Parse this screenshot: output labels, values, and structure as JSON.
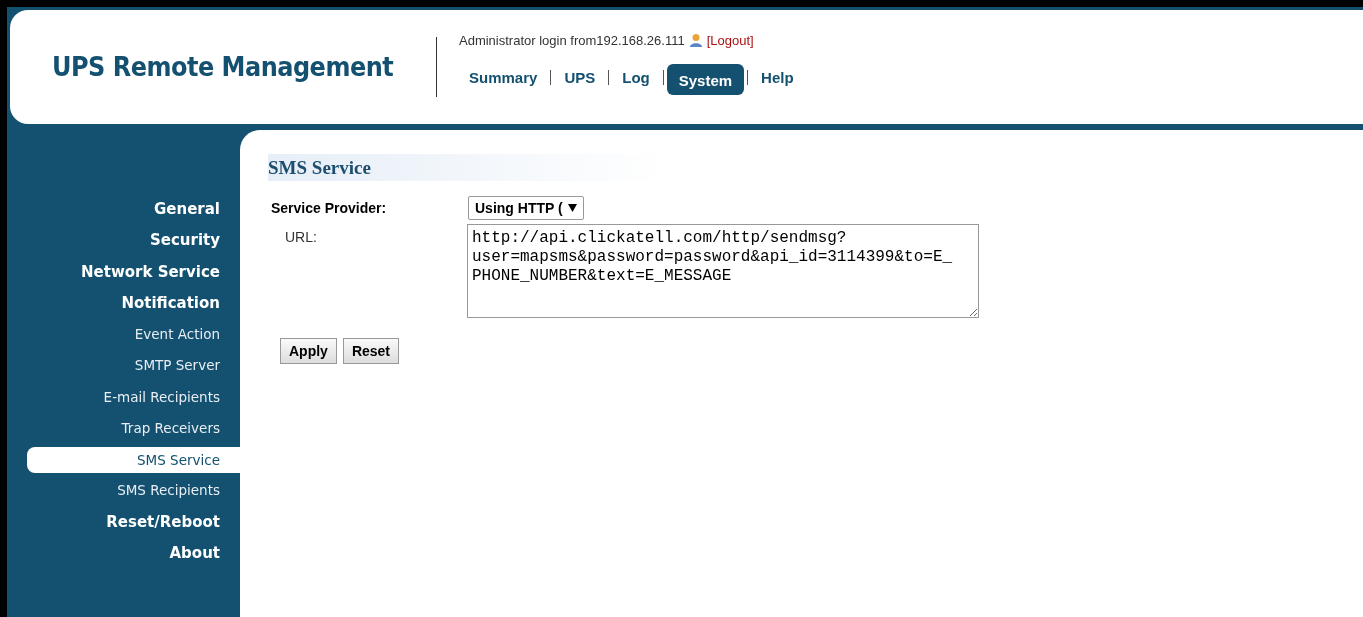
{
  "header": {
    "title": "UPS Remote Management",
    "login_text": "Administrator login from192.168.26.111",
    "logout_link": "[Logout]",
    "nav": [
      {
        "label": "Summary",
        "selected": false
      },
      {
        "label": "UPS",
        "selected": false
      },
      {
        "label": "Log",
        "selected": false
      },
      {
        "label": "System",
        "selected": true
      },
      {
        "label": "Help",
        "selected": false
      }
    ]
  },
  "sidebar": {
    "items": [
      {
        "label": "General",
        "kind": "section",
        "selected": false
      },
      {
        "label": "Security",
        "kind": "section",
        "selected": false
      },
      {
        "label": "Network Service",
        "kind": "section",
        "selected": false
      },
      {
        "label": "Notification",
        "kind": "section",
        "selected": false
      },
      {
        "label": "Event Action",
        "kind": "sub",
        "selected": false
      },
      {
        "label": "SMTP Server",
        "kind": "sub",
        "selected": false
      },
      {
        "label": "E-mail Recipients",
        "kind": "sub",
        "selected": false
      },
      {
        "label": "Trap Receivers",
        "kind": "sub",
        "selected": false
      },
      {
        "label": "SMS Service",
        "kind": "sub",
        "selected": true
      },
      {
        "label": "SMS Recipients",
        "kind": "sub",
        "selected": false
      },
      {
        "label": "Reset/Reboot",
        "kind": "section",
        "selected": false
      },
      {
        "label": "About",
        "kind": "section",
        "selected": false
      }
    ]
  },
  "content": {
    "title": "SMS Service",
    "provider_label": "Service Provider:",
    "provider_value": "Using HTTP (",
    "url_label": "URL:",
    "url_value": "http://api.clickatell.com/http/sendmsg?user=mapsms&password=password&api_id=3114399&to=E_PHONE_NUMBER&text=E_MESSAGE",
    "buttons": [
      "Apply",
      "Reset"
    ]
  }
}
